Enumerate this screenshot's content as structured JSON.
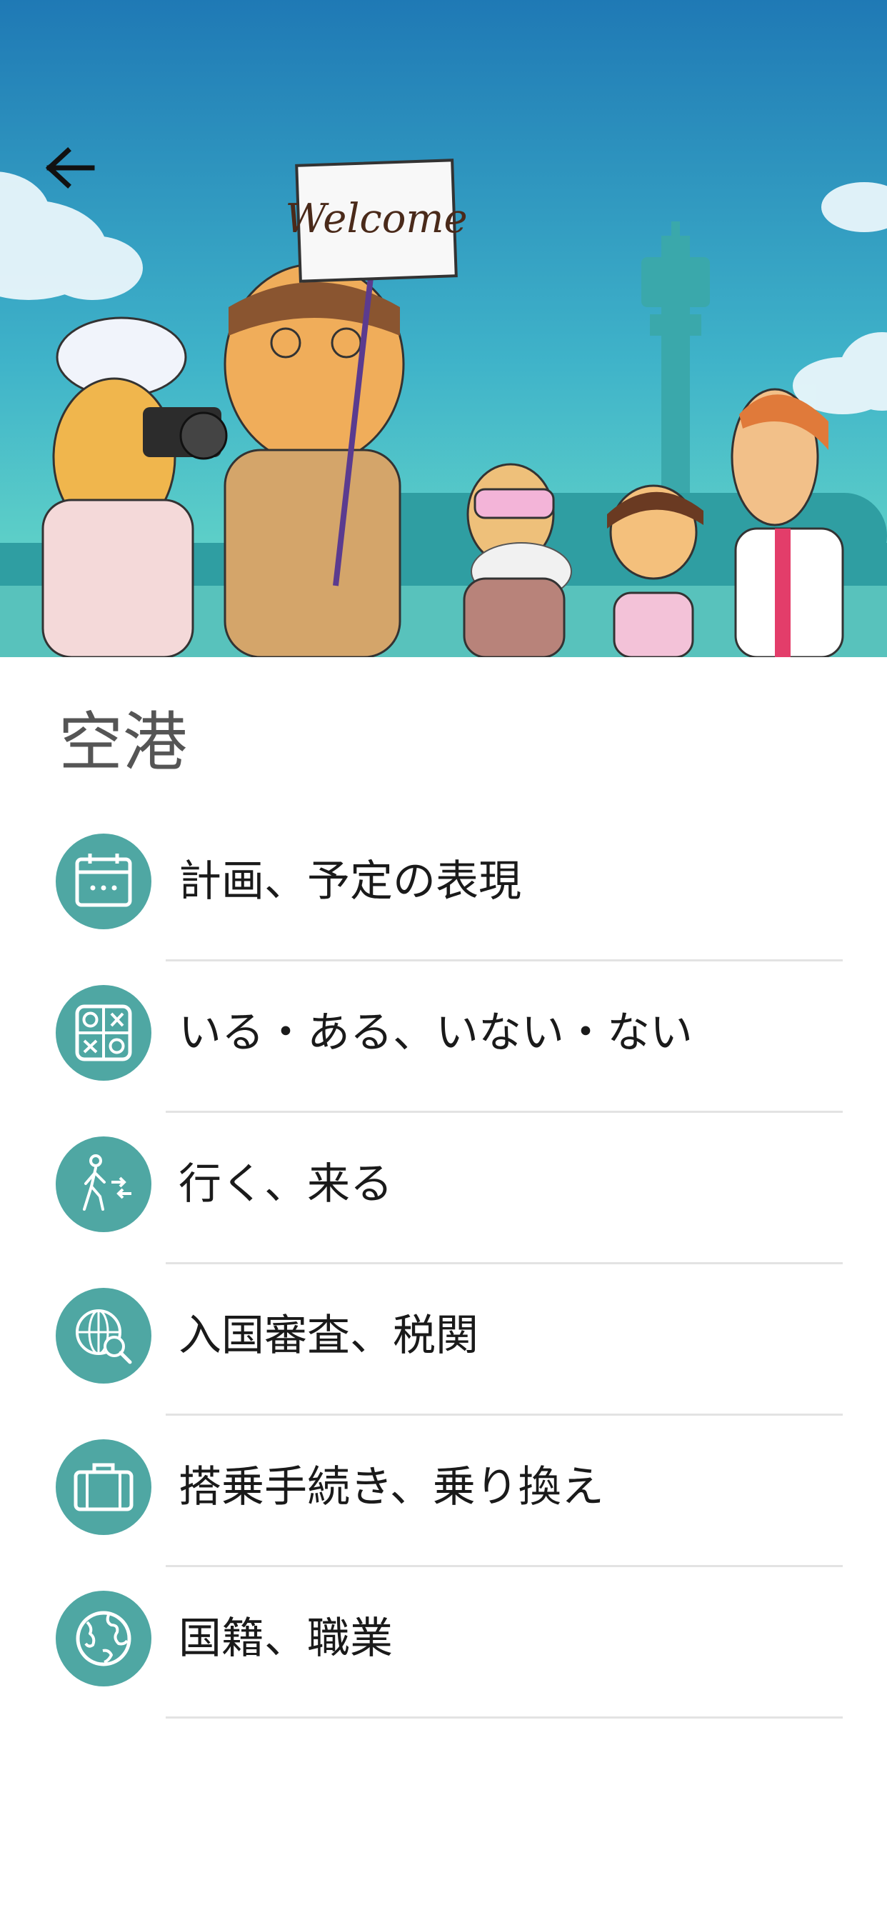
{
  "header": {
    "back_icon": "arrow-left-icon",
    "banner_sign_text": "Welcome"
  },
  "page": {
    "title": "空港"
  },
  "topics": [
    {
      "label": "計画、予定の表現",
      "icon": "calendar-icon"
    },
    {
      "label": "いる・ある、いない・ない",
      "icon": "grid-shapes-icon"
    },
    {
      "label": "行く、来る",
      "icon": "walking-person-icon"
    },
    {
      "label": "入国審査、税関",
      "icon": "globe-search-icon"
    },
    {
      "label": "搭乗手続き、乗り換え",
      "icon": "briefcase-icon"
    },
    {
      "label": "国籍、職業",
      "icon": "globe-icon"
    }
  ],
  "colors": {
    "accent": "#4fa7a3",
    "sky_top": "#1f79b5",
    "sky_bottom": "#5fd7c8",
    "title_text": "#555555",
    "label_text": "#1a1a1a",
    "divider": "#e3e3e3"
  }
}
